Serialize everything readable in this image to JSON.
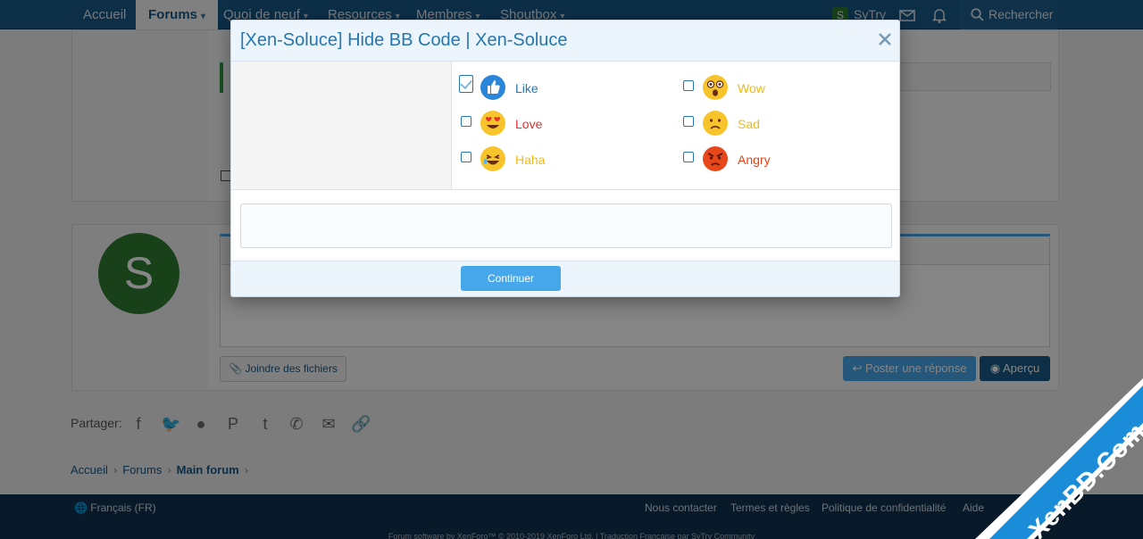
{
  "nav": {
    "tabs": [
      {
        "label": "Accueil"
      },
      {
        "label": "Forums"
      },
      {
        "label": "Quoi de neuf"
      },
      {
        "label": "Resources"
      },
      {
        "label": "Membres"
      },
      {
        "label": "Shoutbox"
      }
    ],
    "user_initial": "S",
    "user_name": "SyTry",
    "search_label": "Rechercher"
  },
  "page": {
    "avatar_initial": "S",
    "attach_label": "Joindre des fichiers",
    "post_reply_label": "Poster une réponse",
    "preview_label": "Aperçu",
    "share_label": "Partager:",
    "breadcrumb": [
      "Accueil",
      "Forums",
      "Main forum"
    ],
    "footer_language": "Français (FR)",
    "footer_links": [
      "Nous contacter",
      "Termes et règles",
      "Politique de confidentialité",
      "Aide"
    ],
    "footer_copyright": "Forum software by XenForo™ © 2010-2019 XenForo Ltd. | Traduction Française par SyTry Community"
  },
  "modal": {
    "title": "[Xen-Soluce] Hide BB Code | Xen-Soluce",
    "reactions": [
      {
        "label": "Like",
        "checked": true,
        "color": "#2577b1"
      },
      {
        "label": "Love",
        "checked": false,
        "color": "#e03030"
      },
      {
        "label": "Haha",
        "checked": false,
        "color": "#f0ba17"
      },
      {
        "label": "Wow",
        "checked": false,
        "color": "#f0ba17"
      },
      {
        "label": "Sad",
        "checked": false,
        "color": "#f0ba17"
      },
      {
        "label": "Angry",
        "checked": false,
        "color": "#e84210"
      }
    ],
    "continue_label": "Continuer"
  },
  "watermark": "XenBD.Com"
}
